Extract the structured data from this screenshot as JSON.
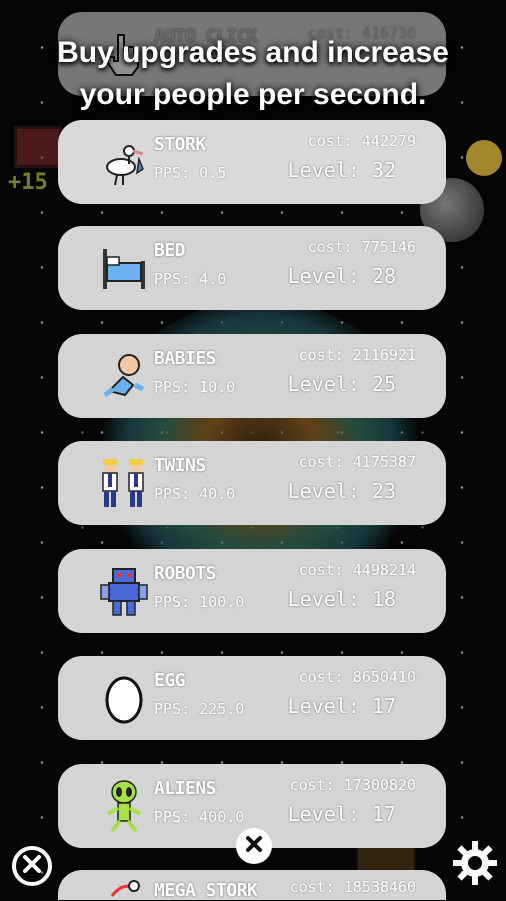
{
  "headline": {
    "line1": "Buy upgrades and increase",
    "line2": "your people per second."
  },
  "background": {
    "counter": "+15"
  },
  "upgrades": [
    {
      "name": "AUTO CLICK",
      "pps": "",
      "cost": "cost: 416736",
      "level": "",
      "icon": "hand-cursor-icon"
    },
    {
      "name": "STORK",
      "pps": "PPS: 0.5",
      "cost": "cost: 442279",
      "level": "Level: 32",
      "icon": "stork-icon"
    },
    {
      "name": "BED",
      "pps": "PPS: 4.0",
      "cost": "cost: 775146",
      "level": "Level: 28",
      "icon": "bed-icon"
    },
    {
      "name": "BABIES",
      "pps": "PPS: 10.0",
      "cost": "cost: 2116921",
      "level": "Level: 25",
      "icon": "baby-icon"
    },
    {
      "name": "TWINS",
      "pps": "PPS: 40.0",
      "cost": "cost: 4175387",
      "level": "Level: 23",
      "icon": "twins-icon"
    },
    {
      "name": "ROBOTS",
      "pps": "PPS: 100.0",
      "cost": "cost: 4498214",
      "level": "Level: 18",
      "icon": "robot-icon"
    },
    {
      "name": "EGG",
      "pps": "PPS: 225.0",
      "cost": "cost: 8650410",
      "level": "Level: 17",
      "icon": "egg-icon"
    },
    {
      "name": "ALIENS",
      "pps": "PPS: 400.0",
      "cost": "cost: 17300820",
      "level": "Level: 17",
      "icon": "alien-icon"
    },
    {
      "name": "MEGA STORK",
      "pps": "",
      "cost": "cost: 18538460",
      "level": "",
      "icon": "mega-stork-icon"
    }
  ],
  "controls": {
    "close_left_icon": "close-circle-icon",
    "close_center_icon": "close-icon",
    "settings_icon": "gear-icon"
  }
}
